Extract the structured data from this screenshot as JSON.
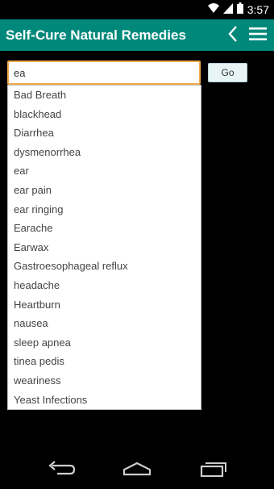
{
  "status": {
    "time": "3:57"
  },
  "app_bar": {
    "title": "Self-Cure Natural Remedies"
  },
  "search": {
    "value": "ea",
    "go_label": "Go"
  },
  "suggestions": [
    "Bad Breath",
    "blackhead",
    "Diarrhea",
    "dysmenorrhea",
    "ear",
    "ear pain",
    "ear ringing",
    "Earache",
    "Earwax",
    "Gastroesophageal reflux",
    "headache",
    "Heartburn",
    "nausea",
    "sleep apnea",
    "tinea pedis",
    "weariness",
    "Yeast Infections"
  ],
  "colors": {
    "app_bar": "#00897b",
    "input_focus": "#f3a94a"
  }
}
